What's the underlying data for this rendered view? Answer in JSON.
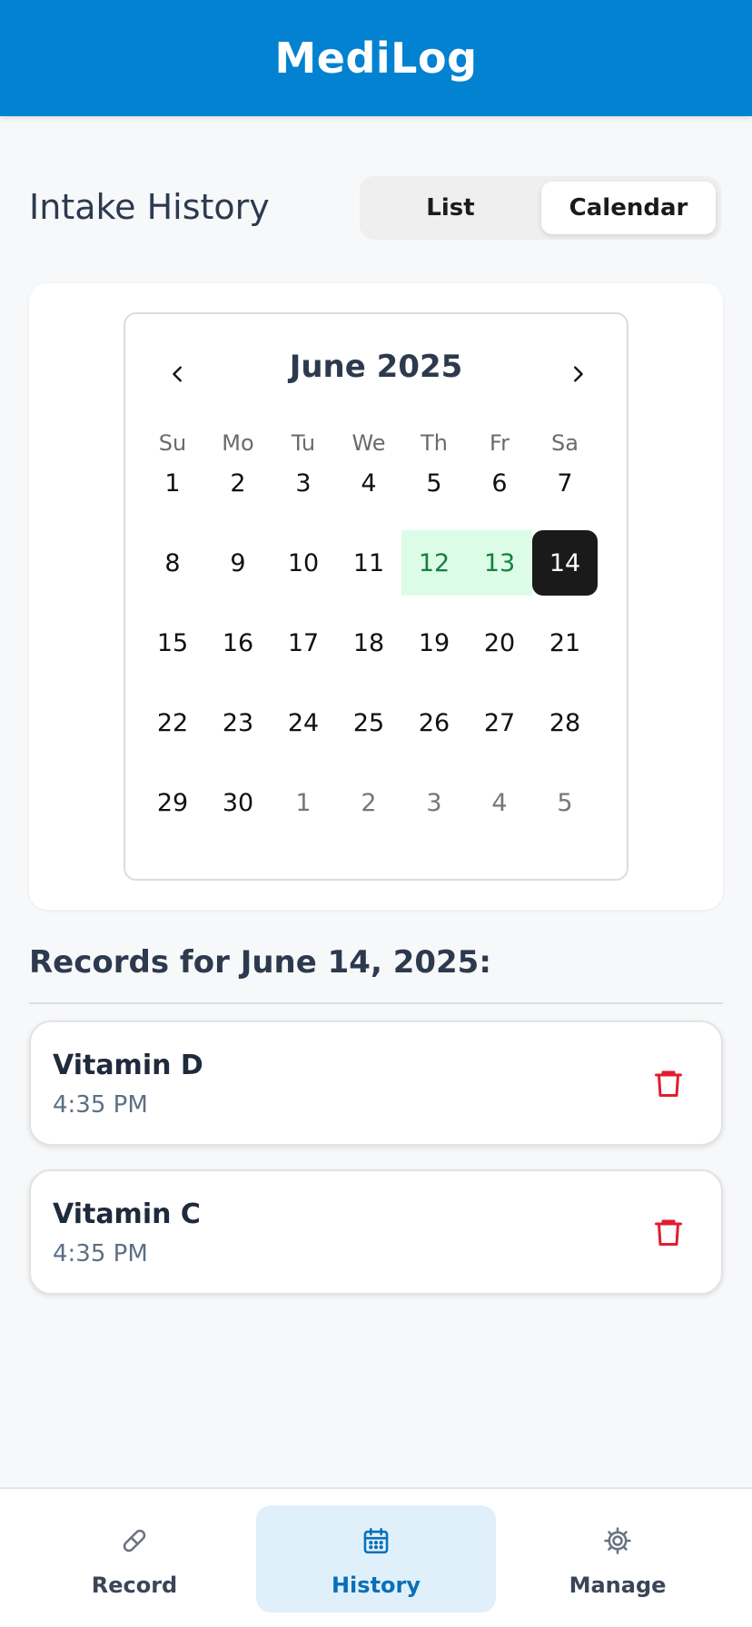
{
  "header": {
    "title": "MediLog"
  },
  "history": {
    "title": "Intake History",
    "toggle": {
      "list_label": "List",
      "calendar_label": "Calendar",
      "active": "Calendar"
    }
  },
  "calendar": {
    "month_label": "June 2025",
    "weekdays": [
      "Su",
      "Mo",
      "Tu",
      "We",
      "Th",
      "Fr",
      "Sa"
    ],
    "weeks": [
      [
        "1",
        "2",
        "3",
        "4",
        "5",
        "6",
        "7"
      ],
      [
        "8",
        "9",
        "10",
        "11",
        "12",
        "13",
        "14"
      ],
      [
        "15",
        "16",
        "17",
        "18",
        "19",
        "20",
        "21"
      ],
      [
        "22",
        "23",
        "24",
        "25",
        "26",
        "27",
        "28"
      ],
      [
        "29",
        "30",
        "1",
        "2",
        "3",
        "4",
        "5"
      ]
    ],
    "outside_cells": [
      "4-2",
      "4-3",
      "4-4",
      "4-5",
      "4-6"
    ],
    "highlighted_cells": [
      "1-4",
      "1-5"
    ],
    "selected_cell": "1-6",
    "colors": {
      "highlight_bg": "#dcfce7",
      "highlight_text": "#15803d",
      "selected_bg": "#1a1a1a"
    }
  },
  "records": {
    "title": "Records for June 14, 2025:",
    "items": [
      {
        "name": "Vitamin D",
        "time": "4:35 PM"
      },
      {
        "name": "Vitamin C",
        "time": "4:35 PM"
      }
    ]
  },
  "nav": {
    "items": [
      {
        "label": "Record",
        "icon": "pill-icon"
      },
      {
        "label": "History",
        "icon": "calendar-icon",
        "active": true
      },
      {
        "label": "Manage",
        "icon": "gear-icon"
      }
    ]
  },
  "colors": {
    "brand": "#0282d1",
    "delete": "#e11d2e",
    "nav_active_bg": "#dff0fb",
    "nav_active_text": "#0a6fb8"
  }
}
